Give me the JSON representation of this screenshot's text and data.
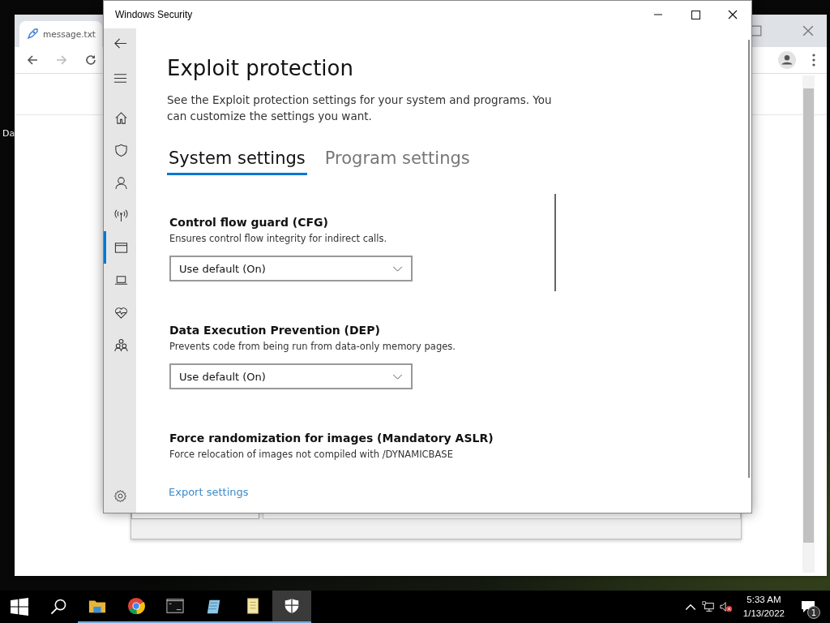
{
  "desktop_icons": [
    {
      "label": "Da"
    }
  ],
  "browser": {
    "tab_title": "message.txt"
  },
  "security_window": {
    "title": "Windows Security",
    "sidebar": [
      {
        "kind": "home",
        "selected": false
      },
      {
        "kind": "shield",
        "selected": false
      },
      {
        "kind": "account",
        "selected": false
      },
      {
        "kind": "network",
        "selected": false
      },
      {
        "kind": "app",
        "selected": true
      },
      {
        "kind": "device",
        "selected": false
      },
      {
        "kind": "health",
        "selected": false
      },
      {
        "kind": "family",
        "selected": false
      }
    ],
    "page": {
      "title": "Exploit protection",
      "description": "See the Exploit protection settings for your system and programs.  You can customize the settings you want.",
      "tabs": [
        {
          "label": "System settings",
          "selected": true
        },
        {
          "label": "Program settings",
          "selected": false
        }
      ],
      "sections": [
        {
          "title": "Control flow guard (CFG)",
          "description": "Ensures control flow integrity for indirect calls.",
          "dropdown": {
            "value": "Use default (On)"
          }
        },
        {
          "title": "Data Execution Prevention (DEP)",
          "description": "Prevents code from being run from data-only memory pages.",
          "dropdown": {
            "value": "Use default (On)"
          }
        },
        {
          "title": "Force randomization for images (Mandatory ASLR)",
          "description": "Force relocation of images not compiled with /DYNAMICBASE"
        }
      ],
      "link": "Export settings"
    }
  },
  "taskbar": {
    "apps": [
      {
        "kind": "explorer",
        "running": true,
        "active": false
      },
      {
        "kind": "chrome",
        "running": true,
        "active": false
      },
      {
        "kind": "terminal",
        "running": true,
        "active": false
      },
      {
        "kind": "notepad-pad",
        "running": true,
        "active": false
      },
      {
        "kind": "scroll",
        "running": true,
        "active": false
      },
      {
        "kind": "security",
        "running": true,
        "active": true
      }
    ],
    "time": "5:33 AM",
    "date": "1/13/2022",
    "notifications": "1"
  }
}
